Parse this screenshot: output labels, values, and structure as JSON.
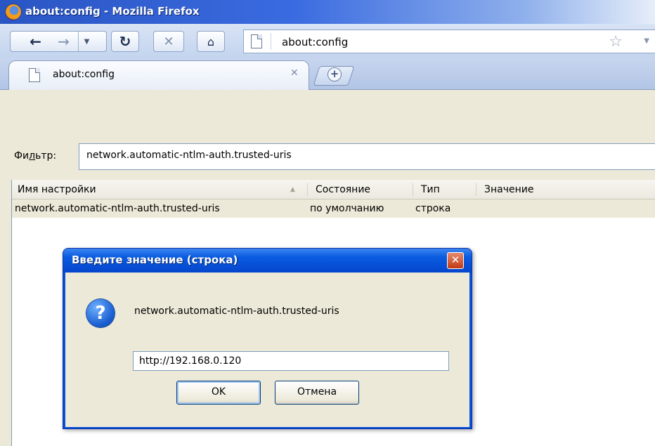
{
  "window": {
    "title": "about:config - Mozilla Firefox"
  },
  "navbar": {
    "back_icon": "back-arrow-icon",
    "forward_icon": "forward-arrow-icon",
    "history_dropdown_icon": "chevron-down-icon",
    "reload_icon": "reload-icon",
    "stop_icon": "stop-icon",
    "home_icon": "home-icon",
    "url": "about:config",
    "bookmark_icon": "star-icon"
  },
  "tabs": {
    "items": [
      {
        "label": "about:config"
      }
    ],
    "new_tab_icon": "plus-icon"
  },
  "filter": {
    "label_pre": "Фи",
    "label_underlined": "л",
    "label_post": "ьтр:",
    "value": "network.automatic-ntlm-auth.trusted-uris"
  },
  "prefs": {
    "columns": [
      "Имя настройки",
      "Состояние",
      "Тип",
      "Значение"
    ],
    "rows": [
      {
        "name": "network.automatic-ntlm-auth.trusted-uris",
        "status": "по умолчанию",
        "type": "строка",
        "value": ""
      }
    ]
  },
  "dialog": {
    "title": "Введите значение (строка)",
    "close_glyph": "✕",
    "prompt": "network.automatic-ntlm-auth.trusted-uris",
    "input_value": "http://192.168.0.120",
    "ok_label": "OK",
    "cancel_label": "Отмена"
  },
  "colors": {
    "titlebar": "#2a55c4",
    "dialog_title": "#0a5ce0",
    "close_button": "#c23a14",
    "chrome_bg": "#ece9d8"
  }
}
